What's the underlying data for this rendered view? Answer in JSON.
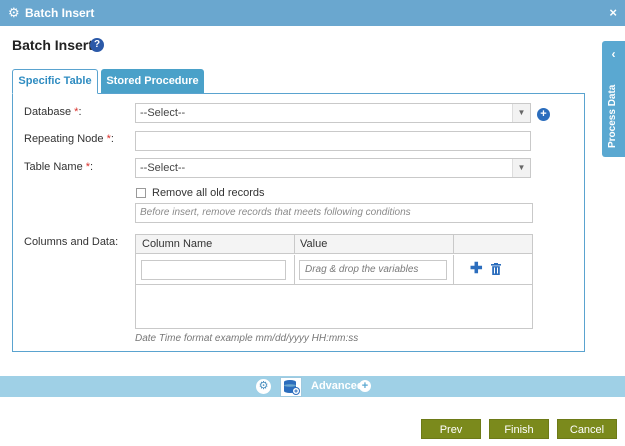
{
  "window": {
    "title": "Batch Insert",
    "close_glyph": "×",
    "icon": "gear-icon"
  },
  "heading": {
    "text": "Batch Insert",
    "help_glyph": "?"
  },
  "tabs": [
    {
      "label": "Specific Table",
      "active": true
    },
    {
      "label": "Stored Procedure",
      "active": false
    }
  ],
  "form": {
    "database": {
      "label": "Database ",
      "required": "*",
      "colon": ":",
      "value": "--Select--"
    },
    "repeating_node": {
      "label": "Repeating Node ",
      "required": "*",
      "colon": ":",
      "value": ""
    },
    "table_name": {
      "label": "Table Name ",
      "required": "*",
      "colon": ":",
      "value": "--Select--"
    },
    "remove_all": {
      "label": "Remove all old records",
      "checked": false
    },
    "conditions_placeholder": "Before insert, remove records that meets following conditions",
    "columns_label": "Columns and Data:",
    "grid": {
      "headers": [
        "Column Name",
        "Value"
      ],
      "rows": [
        {
          "column_name": "",
          "value_placeholder": "Drag & drop the variables"
        }
      ]
    },
    "footnote": "Date Time format example mm/dd/yyyy HH:mm:ss"
  },
  "side_panel": {
    "label": "Process Data",
    "chevron": "‹"
  },
  "bottom_bar": {
    "advanced_label": "Advanced",
    "plus_glyph": "+"
  },
  "buttons": {
    "prev": "Prev",
    "finish": "Finish",
    "cancel": "Cancel"
  },
  "colors": {
    "accent": "#5aa8d1",
    "button": "#7b8a1c",
    "required": "#d9302b"
  }
}
